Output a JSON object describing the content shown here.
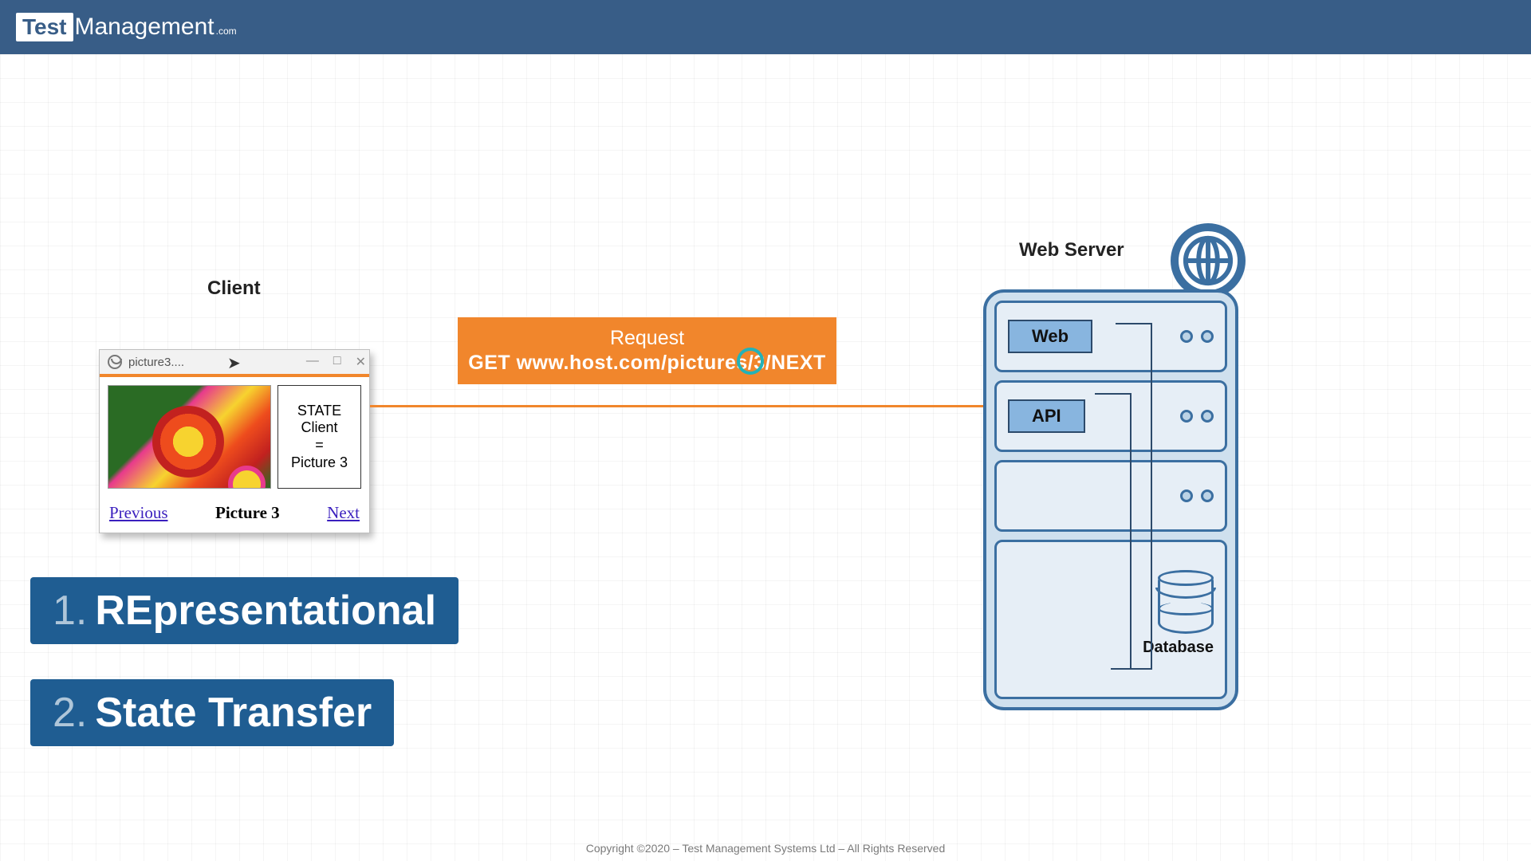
{
  "header": {
    "logo_test": "Test",
    "logo_rest": "Management",
    "logo_dotcom": ".com"
  },
  "client": {
    "label": "Client",
    "window_title": "picture3....",
    "state_line1": "STATE",
    "state_line2": "Client",
    "state_eq": "=",
    "state_line3": "Picture 3",
    "prev": "Previous",
    "current": "Picture 3",
    "next": "Next"
  },
  "request": {
    "line1": "Request",
    "line2": "GET www.host.com/pictures/3/NEXT"
  },
  "server": {
    "label": "Web Server",
    "web": "Web",
    "api": "API",
    "database": "Database"
  },
  "rest": {
    "item1_num": "1.",
    "item1_text": "REpresentational",
    "item2_num": "2.",
    "item2_text": "State Transfer"
  },
  "footer": {
    "text": "Copyright ©2020 – Test Management Systems Ltd – All Rights Reserved"
  }
}
